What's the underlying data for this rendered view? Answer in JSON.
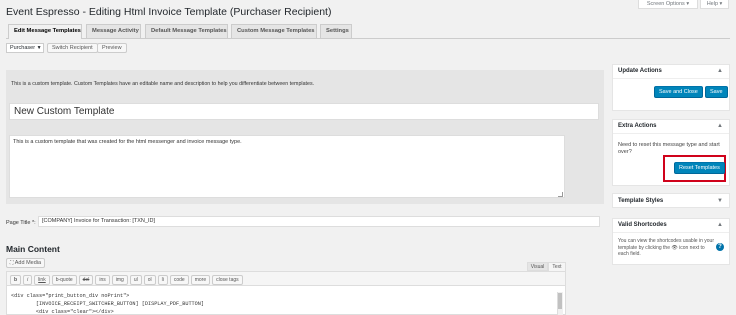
{
  "screen_options": "Screen Options",
  "help": "Help",
  "page_title": "Event Espresso - Editing Html Invoice Template (Purchaser Recipient)",
  "tabs": [
    "Edit Message Templates",
    "Message Activity",
    "Default Message Templates",
    "Custom Message Templates",
    "Settings"
  ],
  "context": {
    "selected": "Purchaser",
    "switch_button": "Switch Recipient",
    "preview_button": "Preview"
  },
  "main": {
    "notice": "This is a custom template. Custom Templates have an editable name and description to help you differentiate between templates.",
    "template_name": "New Custom Template",
    "template_description": "This is a custom template that was created for the html messenger and invoice message type.",
    "page_title_label": "Page Title *:",
    "page_title_value": "[COMPANY] Invoice for Transaction: [TXN_ID]",
    "content_heading": "Main Content",
    "add_media": "Add Media",
    "editor_tabs": [
      "Visual",
      "Text"
    ],
    "quicktags": [
      "b",
      "i",
      "link",
      "b-quote",
      "del",
      "ins",
      "img",
      "ul",
      "ol",
      "li",
      "code",
      "more",
      "close tags"
    ],
    "code_lines": [
      "<div class=\"print_button_div noPrint\">",
      "        [INVOICE_RECEIPT_SWITCHER_BUTTON] [DISPLAY_PDF_BUTTON]",
      "        <div class=\"clear\"></div>"
    ]
  },
  "sidebar": {
    "update_actions": {
      "title": "Update Actions",
      "save_close": "Save and Close",
      "save": "Save"
    },
    "extra_actions": {
      "title": "Extra Actions",
      "text": "Need to reset this message type and start over?",
      "reset": "Reset Templates"
    },
    "template_styles": {
      "title": "Template Styles"
    },
    "valid_shortcodes": {
      "title": "Valid Shortcodes",
      "text_before": "You can view the shortcodes usable in your template by clicking the",
      "text_after": "icon next to each field."
    }
  },
  "colors": {
    "primary": "#0085ba",
    "highlight": "#d0021b",
    "notice_bg": "#e5e5e5"
  }
}
